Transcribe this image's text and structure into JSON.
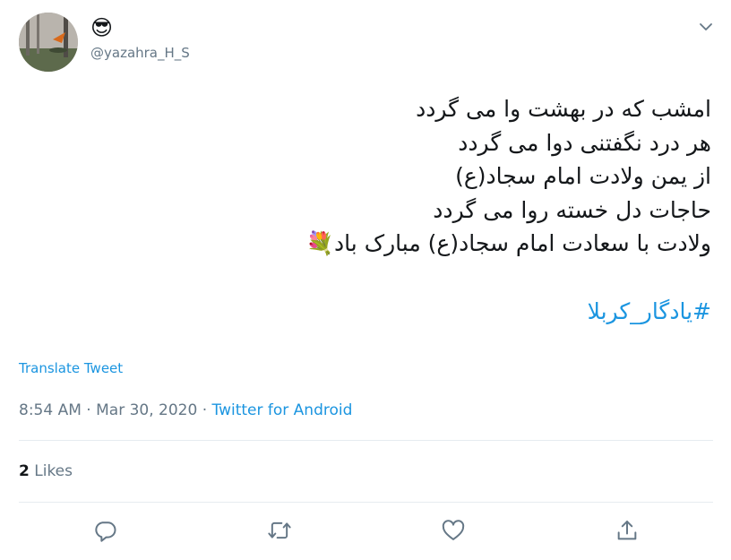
{
  "user": {
    "display_name": "😎",
    "handle": "@yazahra_H_S"
  },
  "tweet": {
    "lines": [
      "امشب که در بهشت وا می گردد",
      "هر درد نگفتنی دوا می گردد",
      "از یمن ولادت امام سجاد(ع)",
      "حاجات دل خسته روا می گردد",
      "ولادت با سعادت امام سجاد(ع) مبارک باد💐"
    ],
    "hashtag": "#یادگار_کربلا"
  },
  "translate_label": "Translate Tweet",
  "meta": {
    "time": "8:54 AM",
    "separator": " · ",
    "date": "Mar 30, 2020",
    "separator2": " · ",
    "source": "Twitter for Android"
  },
  "stats": {
    "likes_count": "2",
    "likes_label": " Likes"
  },
  "actions": {
    "reply_icon": "reply-icon",
    "retweet_icon": "retweet-icon",
    "like_icon": "heart-icon",
    "share_icon": "share-icon"
  },
  "colors": {
    "link": "#1b95e0",
    "muted": "#657786",
    "text": "#14171a",
    "divider": "#e6ecf0"
  }
}
